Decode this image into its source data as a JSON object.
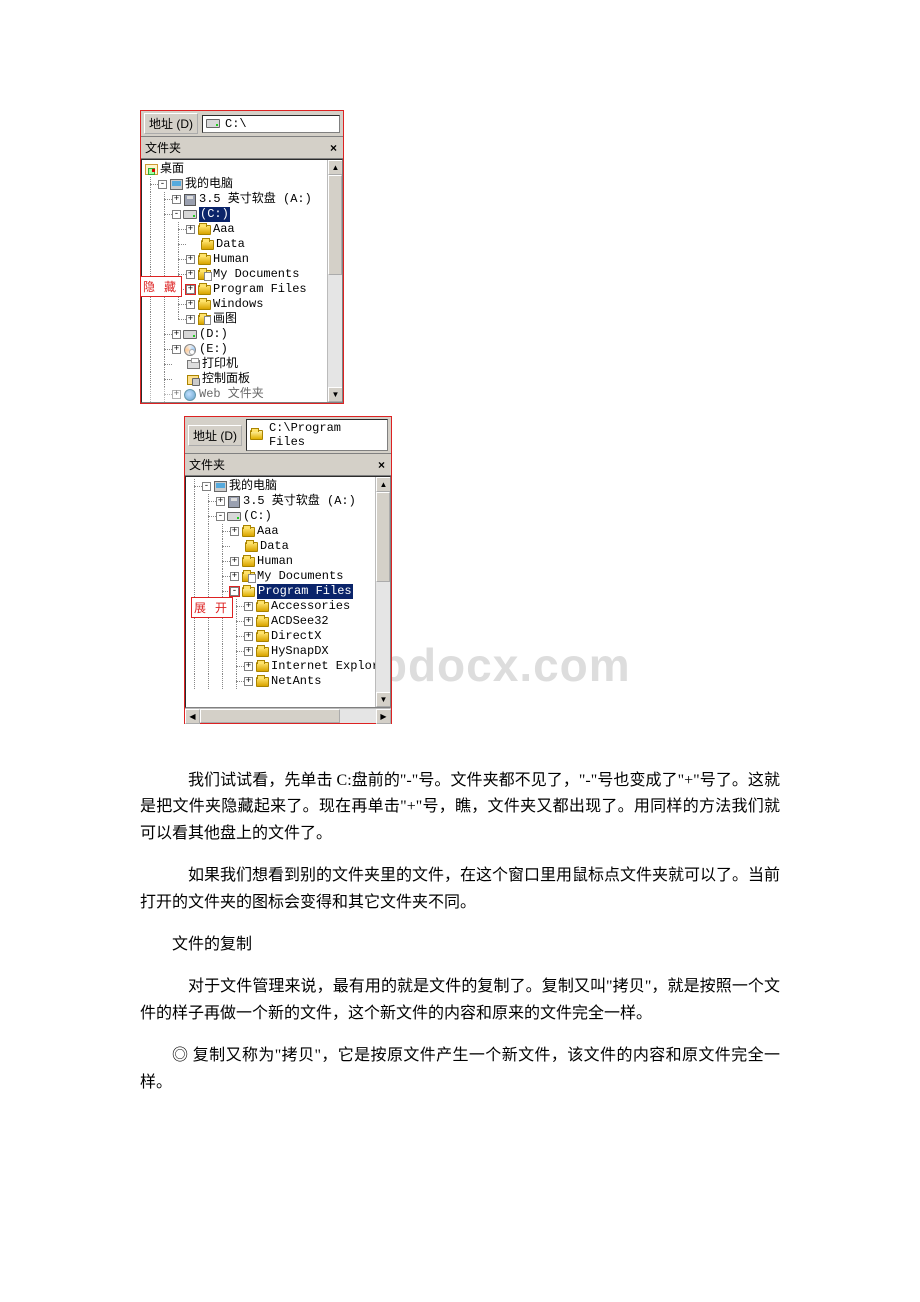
{
  "panel1": {
    "address_label": "地址 (D)",
    "address_path": "C:\\",
    "pane_title": "文件夹",
    "close_x": "×",
    "callout_text": "隐 藏",
    "tree": {
      "desktop": "桌面",
      "mypc": "我的电脑",
      "floppy": "3.5 英寸软盘  (A:)",
      "cdrive": "(C:)",
      "aaa": "Aaa",
      "data": "Data",
      "human": "Human",
      "mydocs": "My Documents",
      "progfiles": "Program Files",
      "windows": "Windows",
      "paint": "画图",
      "ddrive": "(D:)",
      "edrive": "(E:)",
      "printer": "打印机",
      "cpanel": "控制面板",
      "web": "Web 文件夹"
    }
  },
  "panel2": {
    "address_label": "地址 (D)",
    "address_path": "C:\\Program Files",
    "pane_title": "文件夹",
    "close_x": "×",
    "callout_text": "展 开",
    "tree": {
      "mypc": "我的电脑",
      "floppy": "3.5 英寸软盘  (A:)",
      "cdrive": "(C:)",
      "aaa": "Aaa",
      "data": "Data",
      "human": "Human",
      "mydocs": "My Documents",
      "progfiles": "Program Files",
      "accessories": "Accessories",
      "acdsee": "ACDSee32",
      "directx": "DirectX",
      "hysnap": "HySnapDX",
      "ie": "Internet Explor",
      "netants": "NetAnts"
    }
  },
  "watermark": "w.bdocx.com",
  "text": {
    "p1": "我们试试看，先单击 C:盘前的\"-\"号。文件夹都不见了，\"-\"号也变成了\"+\"号了。这就是把文件夹隐藏起来了。现在再单击\"+\"号，瞧，文件夹又都出现了。用同样的方法我们就可以看其他盘上的文件了。",
    "p2": "如果我们想看到别的文件夹里的文件，在这个窗口里用鼠标点文件夹就可以了。当前打开的文件夹的图标会变得和其它文件夹不同。",
    "p3": "文件的复制",
    "p4": "对于文件管理来说，最有用的就是文件的复制了。复制又叫\"拷贝\"，就是按照一个文件的样子再做一个新的文件，这个新文件的内容和原来的文件完全一样。",
    "p5": "◎ 复制又称为\"拷贝\"，它是按原文件产生一个新文件，该文件的内容和原文件完全一样。"
  }
}
